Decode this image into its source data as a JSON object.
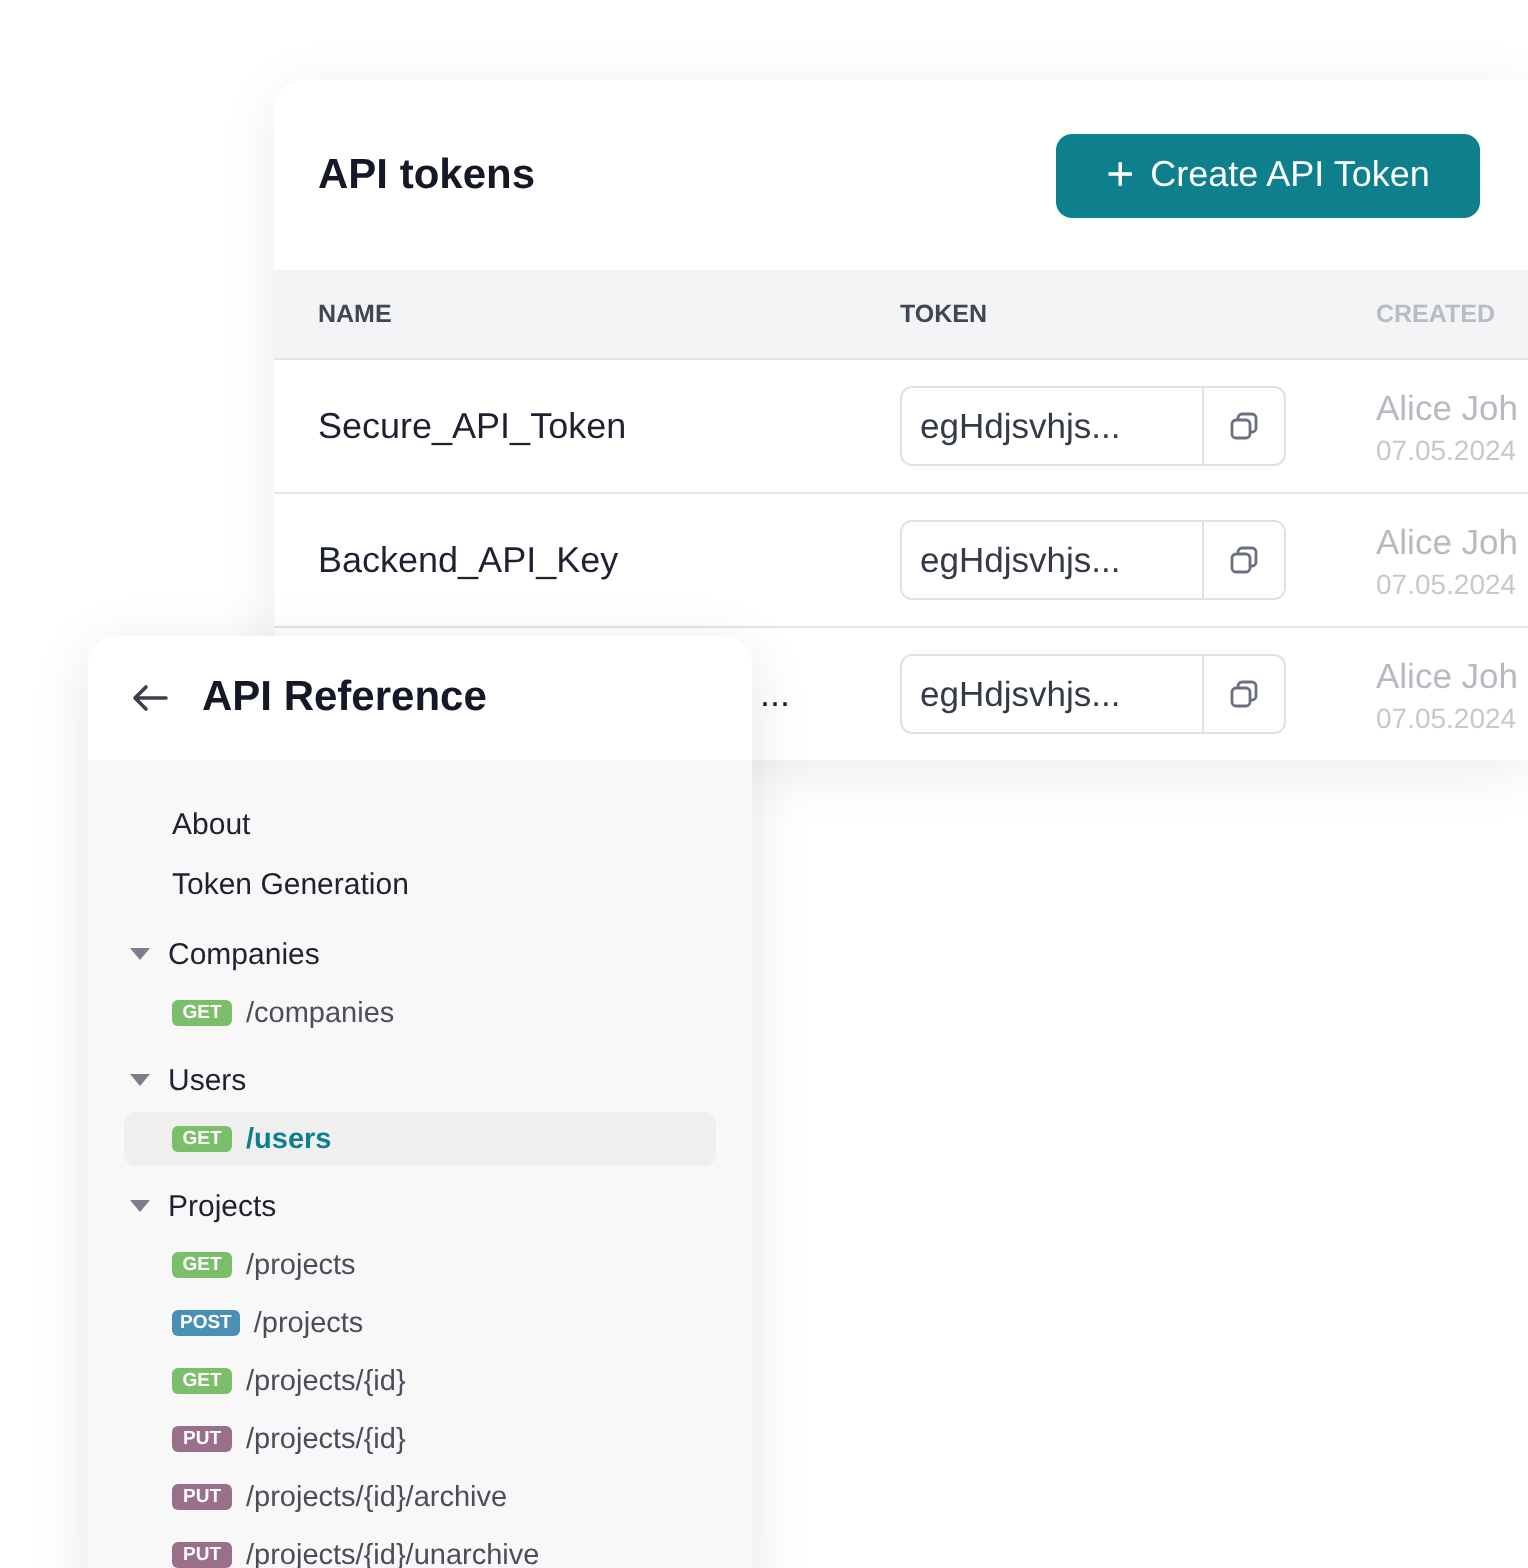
{
  "tokens_panel": {
    "title": "API tokens",
    "create_button": {
      "icon": "+",
      "label": "Create API Token"
    },
    "columns": [
      "NAME",
      "TOKEN",
      "CREATED"
    ],
    "rows": [
      {
        "name": "Secure_API_Token",
        "covered": false,
        "token": "egHdjsvhjs...",
        "created_by": "Alice Joh",
        "created_on": "07.05.2024"
      },
      {
        "name": "Backend_API_Key",
        "covered": false,
        "token": "egHdjsvhjs...",
        "created_by": "Alice Joh",
        "created_on": "07.05.2024"
      },
      {
        "name": "...",
        "covered": true,
        "token": "egHdjsvhjs...",
        "created_by": "Alice Joh",
        "created_on": "07.05.2024"
      }
    ]
  },
  "reference_panel": {
    "title": "API Reference",
    "items": [
      {
        "kind": "link",
        "label": "About"
      },
      {
        "kind": "link",
        "label": "Token Generation"
      },
      {
        "kind": "group",
        "label": "Companies",
        "expanded": true,
        "children": [
          {
            "method": "GET",
            "color": "#7cbf6b",
            "path": "/companies",
            "selected": false
          }
        ]
      },
      {
        "kind": "group",
        "label": "Users",
        "expanded": true,
        "children": [
          {
            "method": "GET",
            "color": "#7cbf6b",
            "path": "/users",
            "selected": true
          }
        ]
      },
      {
        "kind": "group",
        "label": "Projects",
        "expanded": true,
        "children": [
          {
            "method": "GET",
            "color": "#7cbf6b",
            "path": "/projects",
            "selected": false
          },
          {
            "method": "POST",
            "color": "#4a8fb5",
            "path": "/projects",
            "selected": false
          },
          {
            "method": "GET",
            "color": "#7cbf6b",
            "path": "/projects/{id}",
            "selected": false
          },
          {
            "method": "PUT",
            "color": "#9a6f8a",
            "path": "/projects/{id}",
            "selected": false
          },
          {
            "method": "PUT",
            "color": "#9a6f8a",
            "path": "/projects/{id}/archive",
            "selected": false
          },
          {
            "method": "PUT",
            "color": "#9a6f8a",
            "path": "/projects/{id}/unarchive",
            "selected": false
          }
        ]
      }
    ]
  }
}
